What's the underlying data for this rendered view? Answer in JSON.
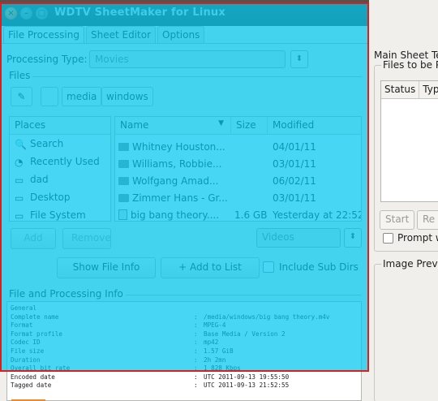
{
  "window": {
    "title": "WDTV SheetMaker for Linux"
  },
  "tabs": [
    {
      "label": "File Processing",
      "active": true
    },
    {
      "label": "Sheet Editor",
      "active": false
    },
    {
      "label": "Options",
      "active": false
    }
  ],
  "processing": {
    "label": "Processing Type:",
    "value": "Movies"
  },
  "files_section": {
    "label": "Files",
    "path_buttons": [
      "media",
      "windows"
    ]
  },
  "places": {
    "header": "Places",
    "items": [
      {
        "label": "Search",
        "icon": "search-icon"
      },
      {
        "label": "Recently Used",
        "icon": "clock-icon"
      },
      {
        "label": "dad",
        "icon": "home-folder-icon"
      },
      {
        "label": "Desktop",
        "icon": "desktop-icon"
      },
      {
        "label": "File System",
        "icon": "drive-icon"
      }
    ]
  },
  "file_list": {
    "columns": [
      "Name",
      "Size",
      "Modified"
    ],
    "rows": [
      {
        "name": "Whitney Houston...",
        "size": "",
        "modified": "04/01/11",
        "type": "folder"
      },
      {
        "name": "Williams, Robbie...",
        "size": "",
        "modified": "03/01/11",
        "type": "folder"
      },
      {
        "name": "Wolfgang Amad...",
        "size": "",
        "modified": "06/02/11",
        "type": "folder"
      },
      {
        "name": "Zimmer Hans - Gr...",
        "size": "",
        "modified": "03/01/11",
        "type": "folder"
      },
      {
        "name": "big bang theory....",
        "size": "1.6 GB",
        "modified": "Yesterday at 22:52",
        "type": "file"
      }
    ]
  },
  "buttons": {
    "add": "Add",
    "remove": "Remove",
    "filter": "Videos",
    "show_file_info": "Show File Info",
    "add_to_list": "+ Add to List",
    "include_sub_dirs": "Include Sub Dirs"
  },
  "info_section": {
    "label": "File and Processing Info",
    "rows": [
      {
        "key": "General",
        "value": ""
      },
      {
        "key": "Complete name",
        "value": "/media/windows/big bang theory.m4v"
      },
      {
        "key": "Format",
        "value": "MPEG-4"
      },
      {
        "key": "Format profile",
        "value": "Base Media / Version 2"
      },
      {
        "key": "Codec ID",
        "value": "mp42"
      },
      {
        "key": "File size",
        "value": "1.57 GiB"
      },
      {
        "key": "Duration",
        "value": "2h 2mn"
      },
      {
        "key": "Overall bit rate",
        "value": "1 828 Kbps"
      },
      {
        "key": "Encoded date",
        "value": "UTC 2011-09-13 19:55:50"
      },
      {
        "key": "Tagged date",
        "value": "UTC 2011-09-13 21:52:55"
      }
    ]
  },
  "background_window": {
    "title": "Main Sheet Te",
    "files_label": "Files to be P",
    "columns": [
      "Status",
      "Typ"
    ],
    "start": "Start",
    "re": "Re",
    "prompt": "Prompt w",
    "image_preview": "Image Previ"
  },
  "colors": {
    "highlight": "#00c8f0",
    "highlight_border": "#e21b1b"
  }
}
